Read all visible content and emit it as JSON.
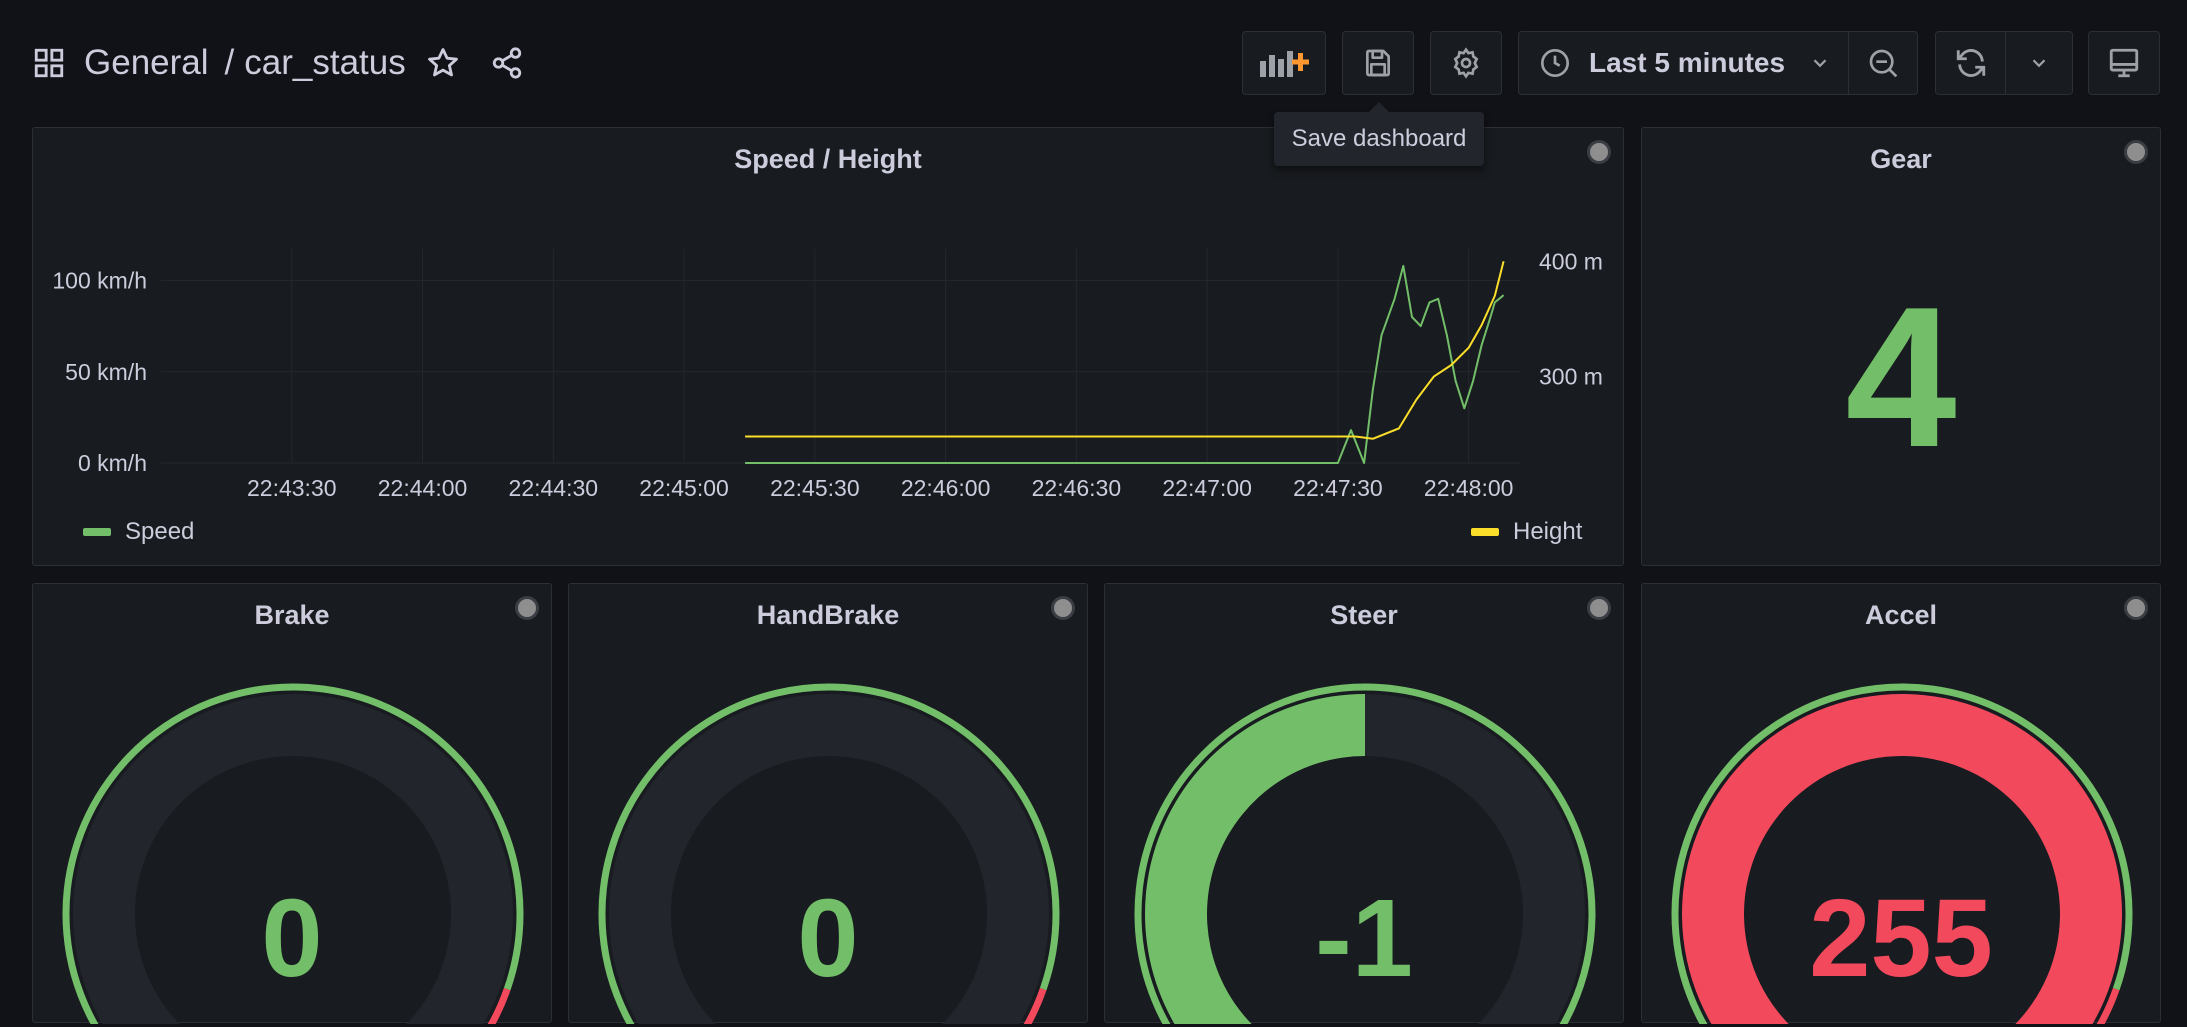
{
  "breadcrumb": {
    "folder": "General",
    "separator": "/",
    "dashboard": "car_status"
  },
  "toolbar": {
    "time_range": "Last 5 minutes",
    "tooltip": "Save dashboard"
  },
  "icons": {
    "apps": "grid-icon",
    "star": "star-icon",
    "share": "share-icon",
    "add_panel": "add-panel-icon",
    "save": "save-icon",
    "settings": "gear-icon",
    "clock": "clock-icon",
    "chevron": "chevron-down-icon",
    "zoom_out": "zoom-out-icon",
    "refresh": "refresh-icon",
    "tv": "monitor-icon"
  },
  "colors": {
    "green": "#73bf69",
    "red": "#f2495c",
    "yellow": "#fade2a",
    "bg": "#111217",
    "panel": "#181b1f"
  },
  "panels": {
    "speed_height": {
      "title": "Speed / Height"
    },
    "gear": {
      "title": "Gear",
      "value": "4"
    },
    "brake": {
      "title": "Brake",
      "value": "0"
    },
    "handbrake": {
      "title": "HandBrake",
      "value": "0"
    },
    "steer": {
      "title": "Steer",
      "value": "-1"
    },
    "accel": {
      "title": "Accel",
      "value": "255"
    }
  },
  "chart_data": {
    "type": "line",
    "title": "Speed / Height",
    "x_ticks": [
      "22:43:30",
      "22:44:00",
      "22:44:30",
      "22:45:00",
      "22:45:30",
      "22:46:00",
      "22:46:30",
      "22:47:00",
      "22:47:30",
      "22:48:00"
    ],
    "y_left_ticks": [
      "0 km/h",
      "50 km/h",
      "100 km/h"
    ],
    "y_right_ticks": [
      "300 m",
      "400 m"
    ],
    "y_left_range": [
      0,
      120
    ],
    "y_right_range": [
      225,
      415
    ],
    "grid": true,
    "legend": {
      "left": "Speed",
      "right": "Height"
    },
    "series": [
      {
        "name": "Speed",
        "axis": "left",
        "color": "#73bf69",
        "points": [
          [
            "22:45:14",
            0
          ],
          [
            "22:47:30",
            0
          ],
          [
            "22:47:33",
            18
          ],
          [
            "22:47:36",
            0
          ],
          [
            "22:47:38",
            40
          ],
          [
            "22:47:40",
            70
          ],
          [
            "22:47:43",
            90
          ],
          [
            "22:47:45",
            108
          ],
          [
            "22:47:47",
            80
          ],
          [
            "22:47:49",
            75
          ],
          [
            "22:47:51",
            88
          ],
          [
            "22:47:53",
            90
          ],
          [
            "22:47:55",
            70
          ],
          [
            "22:47:57",
            45
          ],
          [
            "22:47:59",
            30
          ],
          [
            "22:48:01",
            45
          ],
          [
            "22:48:03",
            65
          ],
          [
            "22:48:05",
            80
          ],
          [
            "22:48:06",
            88
          ],
          [
            "22:48:07",
            90
          ],
          [
            "22:48:08",
            92
          ]
        ]
      },
      {
        "name": "Height",
        "axis": "right",
        "color": "#fade2a",
        "points": [
          [
            "22:45:14",
            248
          ],
          [
            "22:47:34",
            248
          ],
          [
            "22:47:38",
            246
          ],
          [
            "22:47:44",
            255
          ],
          [
            "22:47:48",
            280
          ],
          [
            "22:47:52",
            300
          ],
          [
            "22:47:56",
            310
          ],
          [
            "22:48:00",
            325
          ],
          [
            "22:48:03",
            345
          ],
          [
            "22:48:06",
            370
          ],
          [
            "22:48:08",
            400
          ]
        ]
      }
    ]
  },
  "gauges": {
    "brake": {
      "min": 0,
      "max": 255,
      "value": 0,
      "threshold": 230
    },
    "handbrake": {
      "min": 0,
      "max": 255,
      "value": 0,
      "threshold": 230
    },
    "steer": {
      "min": -1,
      "max": 1,
      "value": -1,
      "threshold": null,
      "fill_to": 0.0
    },
    "accel": {
      "min": 0,
      "max": 255,
      "value": 255,
      "threshold": 230
    }
  }
}
